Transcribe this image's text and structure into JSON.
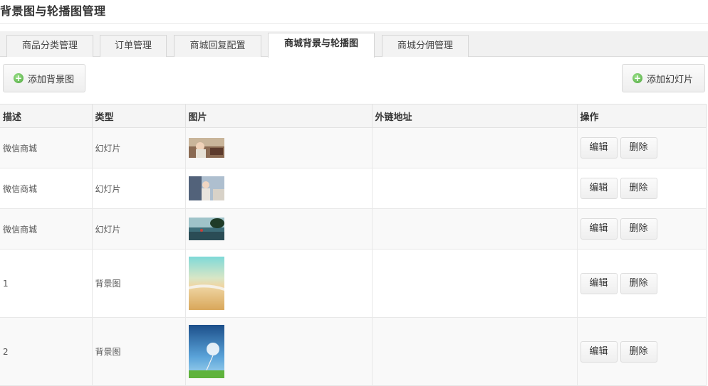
{
  "page": {
    "title": "背景图与轮播图管理"
  },
  "tabs": [
    {
      "label": "商品分类管理",
      "active": false
    },
    {
      "label": "订单管理",
      "active": false
    },
    {
      "label": "商城回复配置",
      "active": false
    },
    {
      "label": "商城背景与轮播图",
      "active": true
    },
    {
      "label": "商城分佣管理",
      "active": false
    }
  ],
  "toolbar": {
    "add_background_label": "添加背景图",
    "add_slide_label": "添加幻灯片"
  },
  "table": {
    "headers": [
      "描述",
      "类型",
      "图片",
      "外链地址",
      "操作"
    ],
    "rows": [
      {
        "desc": "微信商城",
        "type": "幻灯片",
        "link": "",
        "thumb": "slide-1"
      },
      {
        "desc": "微信商城",
        "type": "幻灯片",
        "link": "",
        "thumb": "slide-2"
      },
      {
        "desc": "微信商城",
        "type": "幻灯片",
        "link": "",
        "thumb": "slide-3"
      },
      {
        "desc": "1",
        "type": "背景图",
        "link": "",
        "thumb": "bg-1"
      },
      {
        "desc": "2",
        "type": "背景图",
        "link": "",
        "thumb": "bg-2"
      }
    ],
    "edit_label": "编辑",
    "delete_label": "删除"
  }
}
